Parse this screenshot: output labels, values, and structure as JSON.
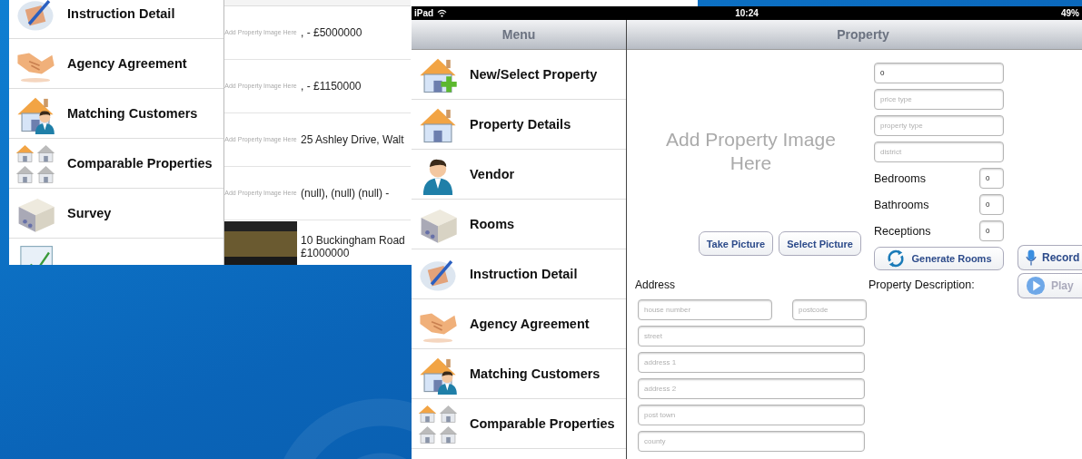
{
  "left_screen": {
    "menu_items": [
      "Instruction Detail",
      "Agency Agreement",
      "Matching Customers",
      "Comparable Properties",
      "Survey"
    ],
    "property_list": [
      {
        "kind": "placeholder",
        "image_text": "Add Property Image Here",
        "text": ",   - £5000000"
      },
      {
        "kind": "placeholder",
        "image_text": "Add Property Image Here",
        "text": ",   - £1150000"
      },
      {
        "kind": "placeholder",
        "image_text": "Add Property Image Here",
        "text": "25 Ashley Drive, Walt"
      },
      {
        "kind": "placeholder",
        "image_text": "Add Property Image Here",
        "text": "(null), (null) (null) -"
      },
      {
        "kind": "photo",
        "text": "10 Buckingham Road",
        "price": "£1000000"
      }
    ]
  },
  "right_screen": {
    "status_bar": {
      "device": "iPad",
      "time": "10:24",
      "battery": "49%"
    },
    "menu": {
      "title": "Menu",
      "items": [
        "New/Select Property",
        "Property Details",
        "Vendor",
        "Rooms",
        "Instruction Detail",
        "Agency Agreement",
        "Matching Customers",
        "Comparable Properties"
      ]
    },
    "property": {
      "title": "Property",
      "image_placeholder": "Add Property Image Here",
      "picture_buttons": [
        "Take Picture",
        "Select Picture"
      ],
      "price_field": {
        "value": "0"
      },
      "fields": [
        {
          "placeholder": "price type"
        },
        {
          "placeholder": "property type"
        },
        {
          "placeholder": "district"
        }
      ],
      "counts": [
        {
          "label": "Bedrooms",
          "value": "0"
        },
        {
          "label": "Bathrooms",
          "value": "0"
        },
        {
          "label": "Receptions",
          "value": "0"
        }
      ],
      "generate_button": "Generate Rooms",
      "address_label": "Address",
      "address_fields": [
        {
          "placeholder": "house number"
        },
        {
          "placeholder": "postcode"
        },
        {
          "placeholder": "street"
        },
        {
          "placeholder": "address 1"
        },
        {
          "placeholder": "address 2"
        },
        {
          "placeholder": "post town"
        },
        {
          "placeholder": "county"
        }
      ],
      "description_label": "Property Description:",
      "record_button": {
        "label": "Record",
        "disabled": false
      },
      "play_button": {
        "label": "Play",
        "disabled": true
      }
    }
  }
}
